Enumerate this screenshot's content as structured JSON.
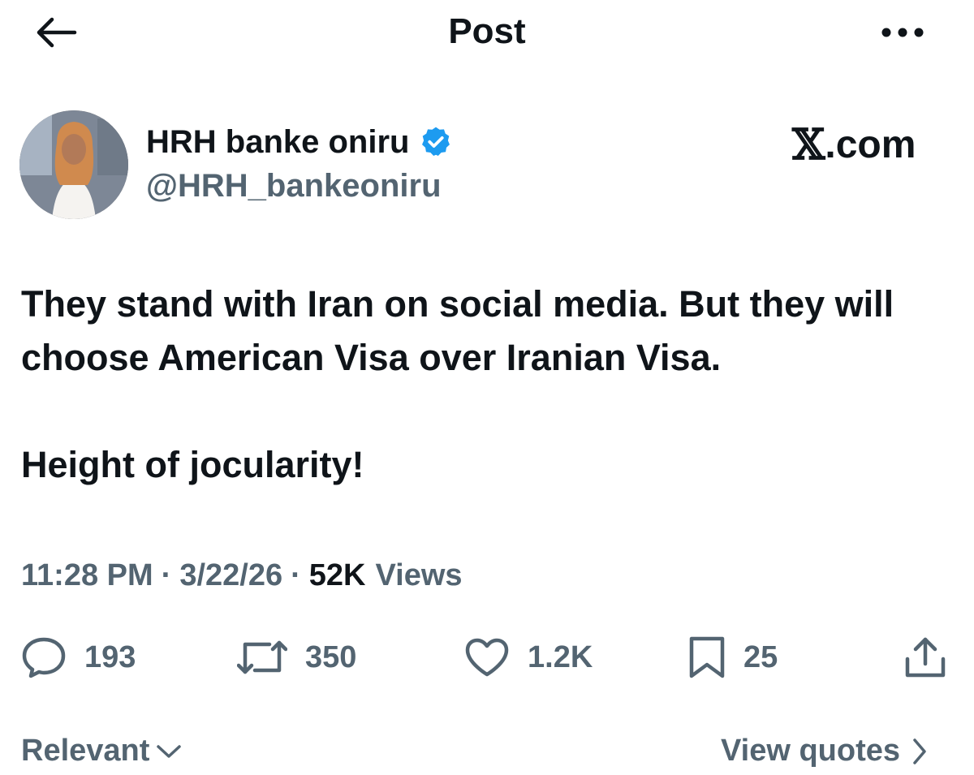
{
  "header": {
    "title": "Post",
    "back_icon": "arrow-left-icon",
    "more_icon": "more-horizontal-icon"
  },
  "author": {
    "display_name": "HRH banke oniru",
    "handle": "@HRH_bankeoniru",
    "verified": true,
    "verified_color": "#1d9bf0"
  },
  "source_badge": {
    "logo": "𝕏",
    "text": ".com"
  },
  "post": {
    "text": "They stand with Iran on social media. But they will choose American Visa over Iranian Visa.\n\nHeight of jocularity!"
  },
  "meta": {
    "time": "11:28 PM",
    "separator": "·",
    "date": "3/22/26",
    "views_count": "52K",
    "views_label": "Views"
  },
  "actions": {
    "replies": "193",
    "reposts": "350",
    "likes": "1.2K",
    "bookmarks": "25"
  },
  "footer": {
    "sort_label": "Relevant",
    "quotes_label": "View quotes"
  },
  "colors": {
    "text_primary": "#0f1419",
    "text_secondary": "#536471",
    "accent": "#1d9bf0"
  }
}
